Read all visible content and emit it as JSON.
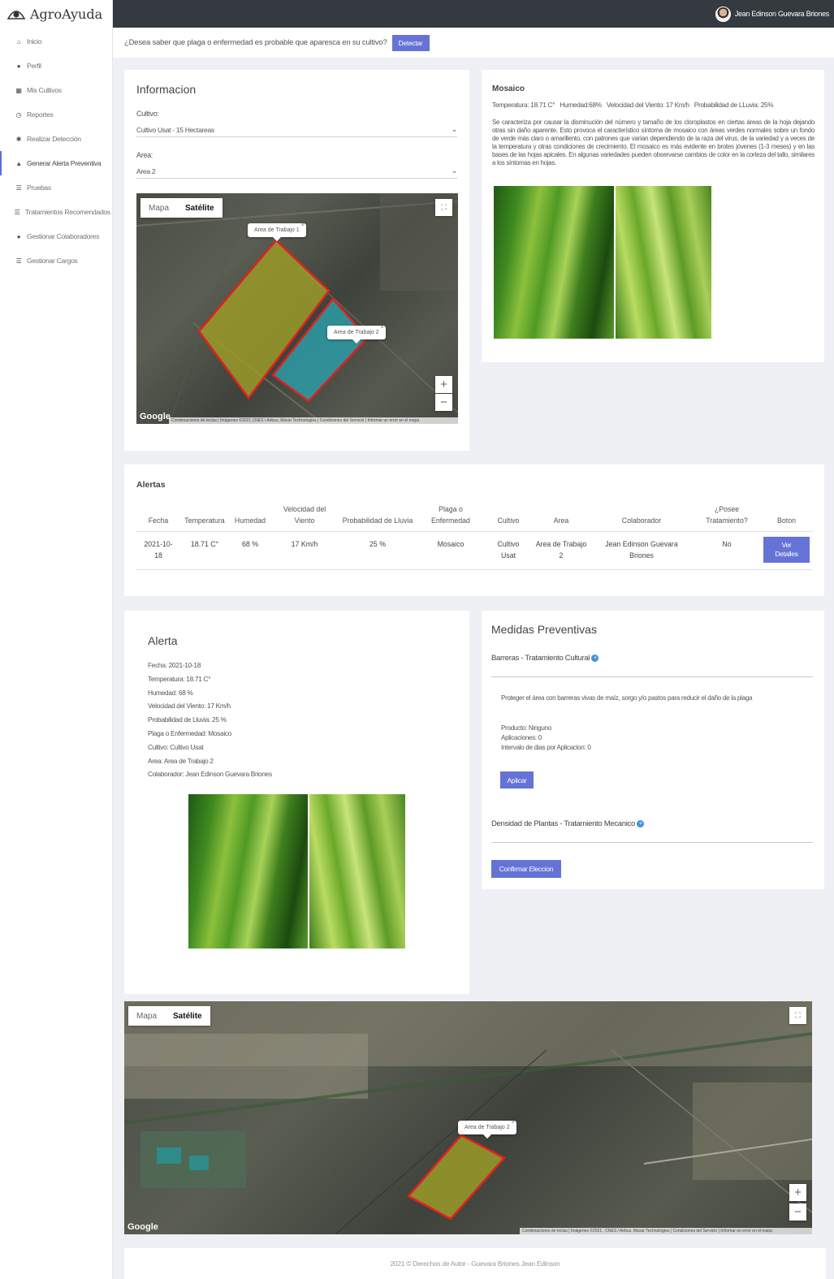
{
  "app": {
    "name": "AgroAyuda"
  },
  "topbar": {
    "user_name": "Jean Edinson Guevara Briones"
  },
  "sidebar": {
    "items": [
      {
        "label": "Inicio",
        "icon": "home-icon"
      },
      {
        "label": "Perfil",
        "icon": "user-icon"
      },
      {
        "label": "Mis Cultivos",
        "icon": "map-icon"
      },
      {
        "label": "Reportes",
        "icon": "clock-icon"
      },
      {
        "label": "Realizar Detección",
        "icon": "bug-icon"
      },
      {
        "label": "Generar Alerta Preventiva",
        "icon": "bell-icon"
      },
      {
        "label": "Pruebas",
        "icon": "list-icon"
      },
      {
        "label": "Tratamientos Recomendados",
        "icon": "list-icon"
      },
      {
        "label": "Gestionar Colaboradores",
        "icon": "user-icon"
      },
      {
        "label": "Gestionar Cargos",
        "icon": "list-icon"
      }
    ],
    "active_index": 5
  },
  "detect": {
    "question": "¿Desea saber que plaga o enfermedad es probable que aparesca en su cultivo?",
    "button": "Detectar"
  },
  "info": {
    "title": "Informacion",
    "cultivo_label": "Cultivo:",
    "cultivo_value": "Cultivo Usat - 15 Hectareas",
    "area_label": "Area:",
    "area_value": "Area 2",
    "map": {
      "mapa": "Mapa",
      "satelite": "Satélite",
      "tip1": "Area de Trabajo 1",
      "tip2": "Area de Trabajo 2",
      "google": "Google",
      "attribution": "Combinaciones de teclas | Imágenes ©2021 CNES / Airbus, Maxar Technologies | Condiciones del Servicio | Informar un error en el mapa"
    }
  },
  "disease": {
    "title": "Mosaico",
    "conditions": "Temperatura: 18.71 C°   Humedad:68%   Velocidad del Viento: 17 Km/h   Probabilidad de LLuvia: 25%",
    "description": "Se caracteriza por causar la disminución del número y tamaño de los cloroplastos en ciertas áreas de la hoja dejando otras sin daño aparente. Esto provoca el característico síntoma de mosaico con áreas verdes normales sobre un fondo de verde más claro o amarillento, con patrones que varían dependiendo de la raza del virus, de la variedad y a veces de la temperatura y otras condiciones de crecimiento. El mosaico es más evidente en brotes jóvenes (1-3 meses) y en las bases de las hojas apicales. En algunas variedades pueden observarse cambios de color en la corteza del tallo, similares a los síntomas en hojas."
  },
  "alerts": {
    "title": "Alertas",
    "headers": [
      "Fecha",
      "Temperatura",
      "Humedad",
      "Velocidad del Viento",
      "Probabilidad de Lluvia",
      "Plaga o Enfermedad",
      "Cultivo",
      "Area",
      "Colaborador",
      "¿Posee Tratamiento?",
      "Boton"
    ],
    "row": [
      "2021-10-18",
      "18.71 C°",
      "68 %",
      "17 Km/h",
      "25 %",
      "Mosaico",
      "Cultivo Usat",
      "Area de Trabajo 2",
      "Jean Edinson Guevara Briones",
      "No"
    ],
    "button": "Ver Detalles"
  },
  "alert_detail": {
    "title": "Alerta",
    "lines": [
      "Fecha: 2021-10-18",
      "Temperatura: 18.71 C°",
      "Humedad: 68 %",
      "Velocidad del Viento: 17 Km/h",
      "Probabilidad de Lluvia: 25 %",
      "Plaga o Enfermedad: Mosaico",
      "Cultivo: Cultivo Usat",
      "Area: Area de Trabajo 2",
      "Colaborador: Jean Edinson Guevara Briones"
    ]
  },
  "preventive": {
    "title": "Medidas Preventivas",
    "m1_title": "Barreras - Tratamiento Cultural",
    "m1_desc": "Proteger el área con barreras vivas de maíz, sorgo y/o pastos para reducir el daño de la plaga",
    "m1_product": "Producto: Ninguno",
    "m1_apps": "Aplicaciones: 0",
    "m1_interval": "Intervalo de dias por Aplicacion: 0",
    "m1_button": "Aplicar",
    "m2_title": "Densidad de Plantas - Tratamiento Mecanico",
    "confirm": "Confirmar Eleccion"
  },
  "bottom_map": {
    "mapa": "Mapa",
    "satelite": "Satélite",
    "tip": "Area de Trabajo 2",
    "google": "Google",
    "attribution": "Combinaciones de teclas | Imágenes ©2021 , CNES / Airbus, Maxar Technologies | Condiciones del Servicio | Informar un error en el mapa"
  },
  "footer": {
    "text": "2021 © Derechos de Autor - Guevara Briones Jean Edinson"
  },
  "colors": {
    "accent": "#6673d6",
    "topbar": "#343a40",
    "area1_fill": "#9a9a28",
    "area2_fill": "#2aa6b4",
    "border_red": "#e02020"
  }
}
